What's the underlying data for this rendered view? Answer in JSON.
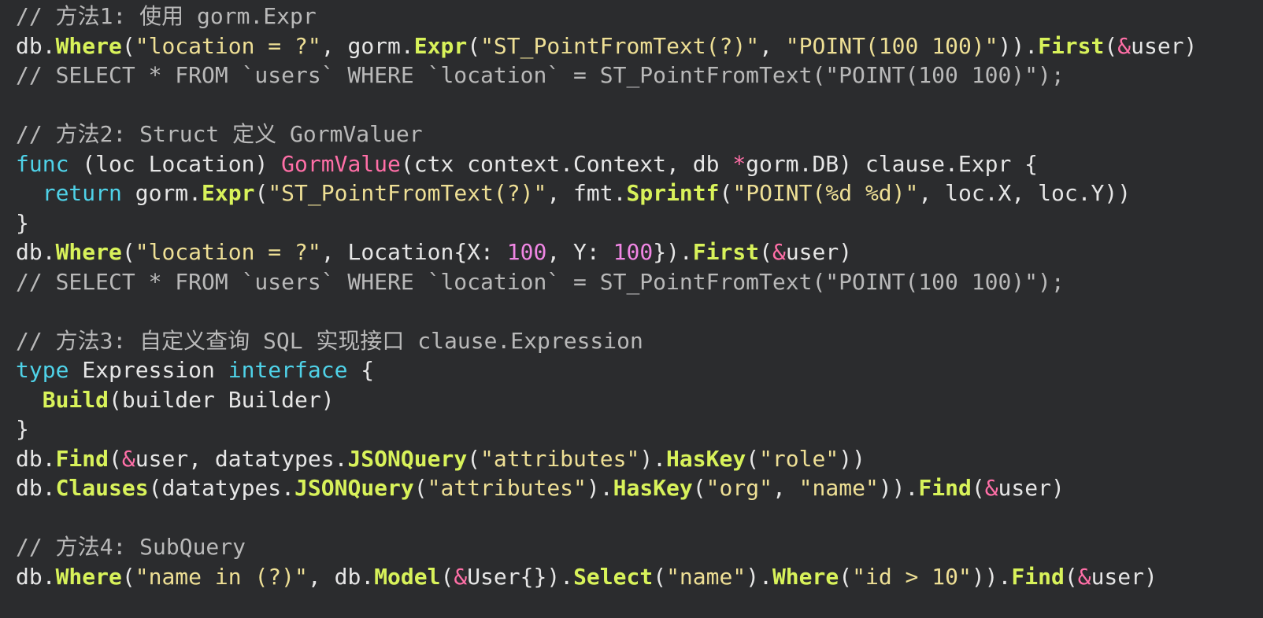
{
  "colors": {
    "background": "#2b2c2e",
    "plain": "#e6e6e6",
    "comment": "#b9b9b9",
    "function_call": "#d8f25a",
    "keyword": "#4fd2e8",
    "string": "#eedf95",
    "method_decl": "#ff6fa7",
    "operator": "#ff6fa7",
    "number": "#f086e4"
  },
  "code_lines": [
    [
      [
        "comment",
        "// 方法1: 使用 gorm.Expr"
      ]
    ],
    [
      [
        "plain",
        "db."
      ],
      [
        "func",
        "Where"
      ],
      [
        "plain",
        "("
      ],
      [
        "string",
        "\"location = ?\""
      ],
      [
        "plain",
        ", gorm."
      ],
      [
        "func",
        "Expr"
      ],
      [
        "plain",
        "("
      ],
      [
        "string",
        "\"ST_PointFromText(?)\""
      ],
      [
        "plain",
        ", "
      ],
      [
        "string",
        "\"POINT(100 100)\""
      ],
      [
        "plain",
        "))."
      ],
      [
        "func",
        "First"
      ],
      [
        "plain",
        "("
      ],
      [
        "op",
        "&"
      ],
      [
        "plain",
        "user)"
      ]
    ],
    [
      [
        "comment",
        "// SELECT * FROM `users` WHERE `location` = ST_PointFromText(\"POINT(100 100)\");"
      ]
    ],
    [],
    [
      [
        "comment",
        "// 方法2: Struct 定义 GormValuer"
      ]
    ],
    [
      [
        "keyword",
        "func"
      ],
      [
        "plain",
        " (loc Location) "
      ],
      [
        "method",
        "GormValue"
      ],
      [
        "plain",
        "(ctx context.Context, db "
      ],
      [
        "op",
        "*"
      ],
      [
        "plain",
        "gorm.DB) clause.Expr {"
      ]
    ],
    [
      [
        "plain",
        "  "
      ],
      [
        "keyword",
        "return"
      ],
      [
        "plain",
        " gorm."
      ],
      [
        "func",
        "Expr"
      ],
      [
        "plain",
        "("
      ],
      [
        "string",
        "\"ST_PointFromText(?)\""
      ],
      [
        "plain",
        ", fmt."
      ],
      [
        "func",
        "Sprintf"
      ],
      [
        "plain",
        "("
      ],
      [
        "string",
        "\"POINT(%d %d)\""
      ],
      [
        "plain",
        ", loc.X, loc.Y))"
      ]
    ],
    [
      [
        "plain",
        "}"
      ]
    ],
    [
      [
        "plain",
        "db."
      ],
      [
        "func",
        "Where"
      ],
      [
        "plain",
        "("
      ],
      [
        "string",
        "\"location = ?\""
      ],
      [
        "plain",
        ", Location{X: "
      ],
      [
        "number",
        "100"
      ],
      [
        "plain",
        ", Y: "
      ],
      [
        "number",
        "100"
      ],
      [
        "plain",
        "})."
      ],
      [
        "func",
        "First"
      ],
      [
        "plain",
        "("
      ],
      [
        "op",
        "&"
      ],
      [
        "plain",
        "user)"
      ]
    ],
    [
      [
        "comment",
        "// SELECT * FROM `users` WHERE `location` = ST_PointFromText(\"POINT(100 100)\");"
      ]
    ],
    [],
    [
      [
        "comment",
        "// 方法3: 自定义查询 SQL 实现接口 clause.Expression"
      ]
    ],
    [
      [
        "keyword",
        "type"
      ],
      [
        "plain",
        " Expression "
      ],
      [
        "keyword",
        "interface"
      ],
      [
        "plain",
        " {"
      ]
    ],
    [
      [
        "plain",
        "  "
      ],
      [
        "func",
        "Build"
      ],
      [
        "plain",
        "(builder Builder)"
      ]
    ],
    [
      [
        "plain",
        "}"
      ]
    ],
    [
      [
        "plain",
        "db."
      ],
      [
        "func",
        "Find"
      ],
      [
        "plain",
        "("
      ],
      [
        "op",
        "&"
      ],
      [
        "plain",
        "user, datatypes."
      ],
      [
        "func",
        "JSONQuery"
      ],
      [
        "plain",
        "("
      ],
      [
        "string",
        "\"attributes\""
      ],
      [
        "plain",
        ")."
      ],
      [
        "func",
        "HasKey"
      ],
      [
        "plain",
        "("
      ],
      [
        "string",
        "\"role\""
      ],
      [
        "plain",
        "))"
      ]
    ],
    [
      [
        "plain",
        "db."
      ],
      [
        "func",
        "Clauses"
      ],
      [
        "plain",
        "(datatypes."
      ],
      [
        "func",
        "JSONQuery"
      ],
      [
        "plain",
        "("
      ],
      [
        "string",
        "\"attributes\""
      ],
      [
        "plain",
        ")."
      ],
      [
        "func",
        "HasKey"
      ],
      [
        "plain",
        "("
      ],
      [
        "string",
        "\"org\""
      ],
      [
        "plain",
        ", "
      ],
      [
        "string",
        "\"name\""
      ],
      [
        "plain",
        "))."
      ],
      [
        "func",
        "Find"
      ],
      [
        "plain",
        "("
      ],
      [
        "op",
        "&"
      ],
      [
        "plain",
        "user)"
      ]
    ],
    [],
    [
      [
        "comment",
        "// 方法4: SubQuery"
      ]
    ],
    [
      [
        "plain",
        "db."
      ],
      [
        "func",
        "Where"
      ],
      [
        "plain",
        "("
      ],
      [
        "string",
        "\"name in (?)\""
      ],
      [
        "plain",
        ", db."
      ],
      [
        "func",
        "Model"
      ],
      [
        "plain",
        "("
      ],
      [
        "op",
        "&"
      ],
      [
        "plain",
        "User{})."
      ],
      [
        "func",
        "Select"
      ],
      [
        "plain",
        "("
      ],
      [
        "string",
        "\"name\""
      ],
      [
        "plain",
        ")."
      ],
      [
        "func",
        "Where"
      ],
      [
        "plain",
        "("
      ],
      [
        "string",
        "\"id > 10\""
      ],
      [
        "plain",
        "))."
      ],
      [
        "func",
        "Find"
      ],
      [
        "plain",
        "("
      ],
      [
        "op",
        "&"
      ],
      [
        "plain",
        "user)"
      ]
    ]
  ]
}
